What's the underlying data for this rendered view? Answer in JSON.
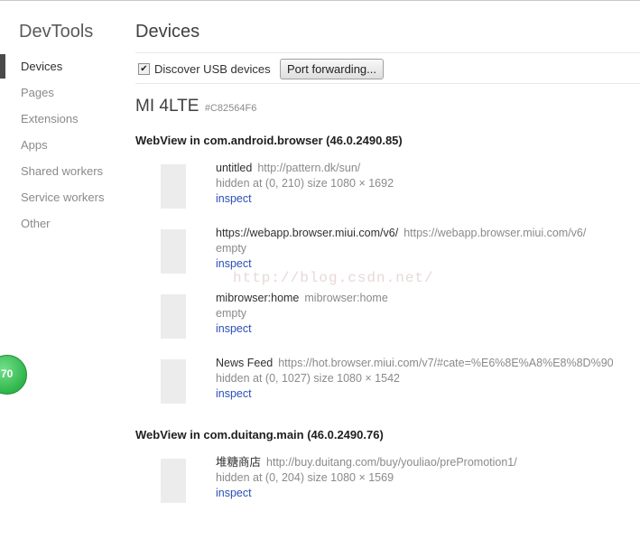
{
  "app_title": "DevTools",
  "sidebar": {
    "items": [
      {
        "label": "Devices"
      },
      {
        "label": "Pages"
      },
      {
        "label": "Extensions"
      },
      {
        "label": "Apps"
      },
      {
        "label": "Shared workers"
      },
      {
        "label": "Service workers"
      },
      {
        "label": "Other"
      }
    ],
    "active": "Devices"
  },
  "main": {
    "title": "Devices",
    "discover_usb_label": "Discover USB devices",
    "discover_usb_checked": true,
    "check_glyph": "✔",
    "port_forwarding_label": "Port forwarding...",
    "device": {
      "name": "MI 4LTE",
      "serial": "#C82564F6",
      "browsers": [
        {
          "heading": "WebView in com.android.browser (46.0.2490.85)",
          "pages": [
            {
              "title": "untitled",
              "url": "http://pattern.dk/sun/",
              "status": "hidden  at (0, 210)  size 1080 × 1692",
              "action": "inspect"
            },
            {
              "title": "https://webapp.browser.miui.com/v6/",
              "url": "https://webapp.browser.miui.com/v6/",
              "status": "empty",
              "action": "inspect"
            },
            {
              "title": "mibrowser:home",
              "url": "mibrowser:home",
              "status": "empty",
              "action": "inspect"
            },
            {
              "title": "News Feed",
              "url": "https://hot.browser.miui.com/v7/#cate=%E6%8E%A8%E8%8D%90",
              "status": "hidden  at (0, 1027)  size 1080 × 1542",
              "action": "inspect"
            }
          ]
        },
        {
          "heading": "WebView in com.duitang.main (46.0.2490.76)",
          "pages": [
            {
              "title": "堆糖商店",
              "url": "http://buy.duitang.com/buy/youliao/prePromotion1/",
              "status": "hidden  at (0, 204)  size 1080 × 1569",
              "action": "inspect"
            }
          ]
        }
      ]
    }
  },
  "watermark": "http://blog.csdn.net/",
  "badge_text": "70",
  "colors": {
    "link": "#2b4fb5",
    "active_bar": "#494949",
    "badge": "#2fb54a"
  }
}
